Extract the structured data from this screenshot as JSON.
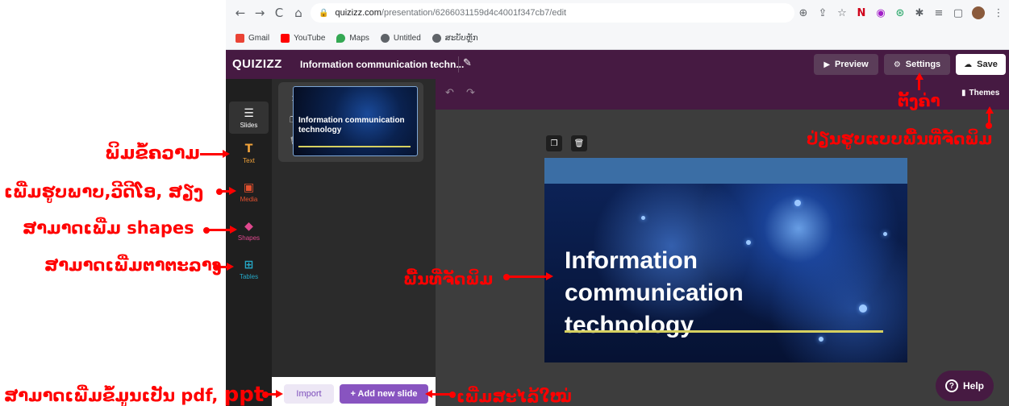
{
  "browser": {
    "url_domain": "quizizz.com",
    "url_path": "/presentation/6266031159d4c4001f347cb7/edit",
    "bookmarks": [
      {
        "label": "Gmail",
        "color": "#ea4335"
      },
      {
        "label": "YouTube",
        "color": "#ff0000"
      },
      {
        "label": "Maps",
        "color": "#34a853"
      },
      {
        "label": "Untitled",
        "color": "#5f6368"
      },
      {
        "label": "ສະບັບຫຼັກ",
        "color": "#5f6368"
      }
    ],
    "nav_icons": {
      "back": "←",
      "forward": "→",
      "reload": "C",
      "home": "⌂"
    },
    "extension_icons": [
      "zoom-icon",
      "share-icon",
      "star-icon",
      "n-extension-icon",
      "purple-extension-icon",
      "green-extension-icon",
      "puzzle-icon",
      "reading-list-icon",
      "window-icon",
      "profile-avatar",
      "menu-icon"
    ]
  },
  "app": {
    "logo": "QUIZIZZ",
    "title": "Information communication techn...",
    "preview_label": "Preview",
    "settings_label": "Settings",
    "save_label": "Save",
    "themes_label": "Themes",
    "help_label": "Help",
    "brand_color": "#461a42",
    "accent_color": "#8854c0"
  },
  "rail": [
    {
      "label": "Slides",
      "icon": "slides-icon"
    },
    {
      "label": "Text",
      "icon": "text-icon"
    },
    {
      "label": "Media",
      "icon": "media-icon"
    },
    {
      "label": "Shapes",
      "icon": "shapes-icon"
    },
    {
      "label": "Tables",
      "icon": "tables-icon"
    }
  ],
  "slide_panel": {
    "slide_number": "1",
    "thumbnail_text": "Information communication technology",
    "import_label": "Import",
    "add_slide_label": "+ Add new slide"
  },
  "slide": {
    "title_line1": "Information",
    "title_line2": "communication",
    "title_line3": "technology"
  },
  "annotations": {
    "text_tool": "ພິມຂໍ້ຄວາມ",
    "media_tool": "ເພີ່ມຮູບພາບ,ວີດີໂອ, ສຽງ",
    "shapes_tool": "ສາມາດເພີ່ມ shapes",
    "tables_tool": "ສາມາດເພີ່ມຕາຕະລາງ",
    "import_data_prefix": "ສາມາດເພີ່ມຂໍ້ມູນເປັນ pdf,",
    "import_data_suffix": "ppt",
    "add_slide": "ເພີ່ມສະໄລ້ໃໝ່",
    "workspace": "ພື້ນທີ່ຈັດພິມ",
    "settings": "ຕັ້ງຄ່າ",
    "themes": "ປ່ຽນຮູບແບບພື້ນທີ່ຈັດພິມ",
    "color": "#ff0000"
  }
}
